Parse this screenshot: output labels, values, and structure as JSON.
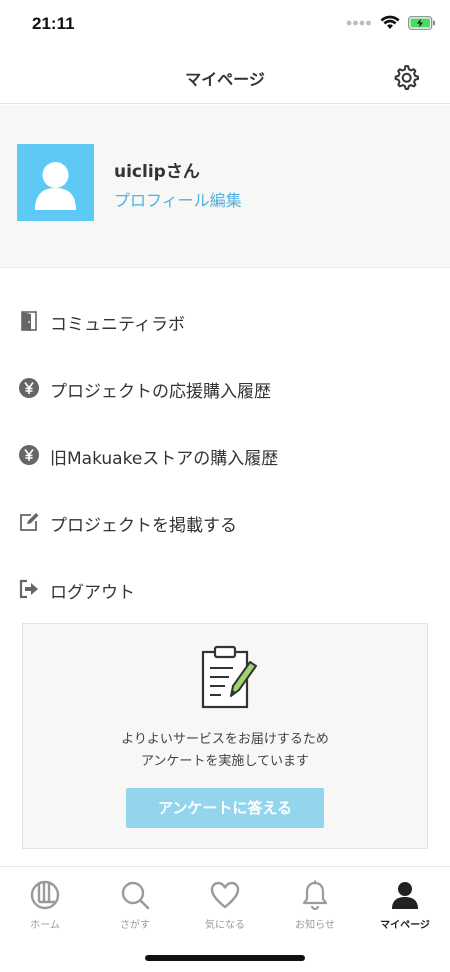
{
  "status_bar": {
    "time": "21:11",
    "icons": [
      "cellular-dots-icon",
      "wifi-icon",
      "battery-charging-icon"
    ],
    "battery_color": "#4cd964"
  },
  "header": {
    "title": "マイページ",
    "settings_icon": "gear-icon"
  },
  "profile": {
    "username": "uiclipさん",
    "edit_label": "プロフィール編集",
    "avatar_color": "#5fc9f5",
    "link_color": "#4fb3e0"
  },
  "menu": {
    "items": [
      {
        "icon": "door-icon",
        "label": "コミュニティラボ"
      },
      {
        "icon": "yen-coin-icon",
        "label": "プロジェクトの応援購入履歴"
      },
      {
        "icon": "yen-coin-icon",
        "label": "旧Makuakeストアの購入履歴"
      },
      {
        "icon": "edit-icon",
        "label": "プロジェクトを掲載する"
      },
      {
        "icon": "logout-icon",
        "label": "ログアウト"
      }
    ]
  },
  "survey": {
    "icon": "clipboard-pencil-icon",
    "line1": "よりよいサービスをお届けするため",
    "line2": "アンケートを実施しています",
    "button_label": "アンケートに答える",
    "button_color": "#94d5ee"
  },
  "tabs": [
    {
      "icon": "home-logo-icon",
      "label": "ホーム",
      "active": false
    },
    {
      "icon": "search-icon",
      "label": "さがす",
      "active": false
    },
    {
      "icon": "heart-icon",
      "label": "気になる",
      "active": false
    },
    {
      "icon": "bell-icon",
      "label": "お知らせ",
      "active": false
    },
    {
      "icon": "person-icon",
      "label": "マイページ",
      "active": true
    }
  ]
}
